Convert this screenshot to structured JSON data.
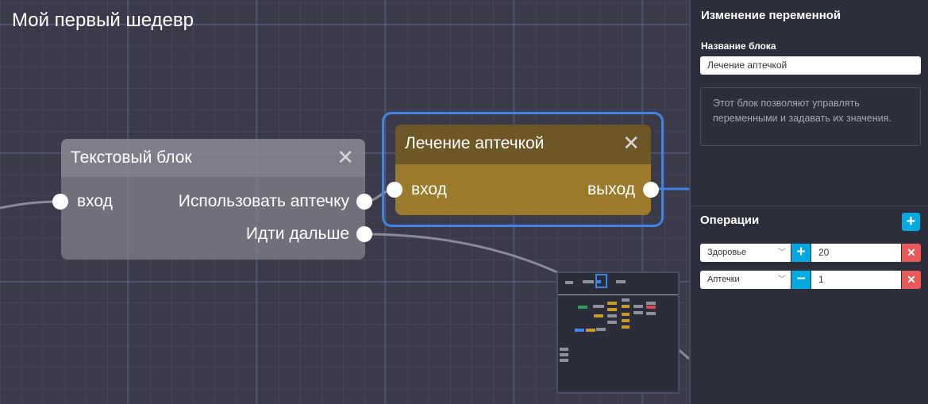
{
  "project": {
    "title": "Мой первый шедевр"
  },
  "nodes": {
    "text_block": {
      "title": "Текстовый блок",
      "input": "вход",
      "outputs": [
        "Использовать аптечку",
        "Идти дальше"
      ]
    },
    "potion_block": {
      "title": "Лечение аптечкой",
      "input": "вход",
      "output": "выход"
    }
  },
  "panel": {
    "title": "Изменение переменной",
    "name_label": "Название блока",
    "name_value": "Лечение аптечкой",
    "description": "Этот блок позволяют управлять переменными и задавать их значения.",
    "operations_title": "Операции",
    "add_icon": "plus-icon",
    "operations": [
      {
        "variable": "Здоровье",
        "operator": "+",
        "value": "20"
      },
      {
        "variable": "Аптечки",
        "operator": "−",
        "value": "1"
      }
    ]
  },
  "colors": {
    "canvas_bg": "#3a3a4b",
    "selection": "#3f86e4",
    "potion_body": "#9c7a2c",
    "potion_header": "#6e5727",
    "accent": "#03a9e0",
    "danger": "#e85a5a",
    "panel_bg": "#2d2e3c"
  }
}
